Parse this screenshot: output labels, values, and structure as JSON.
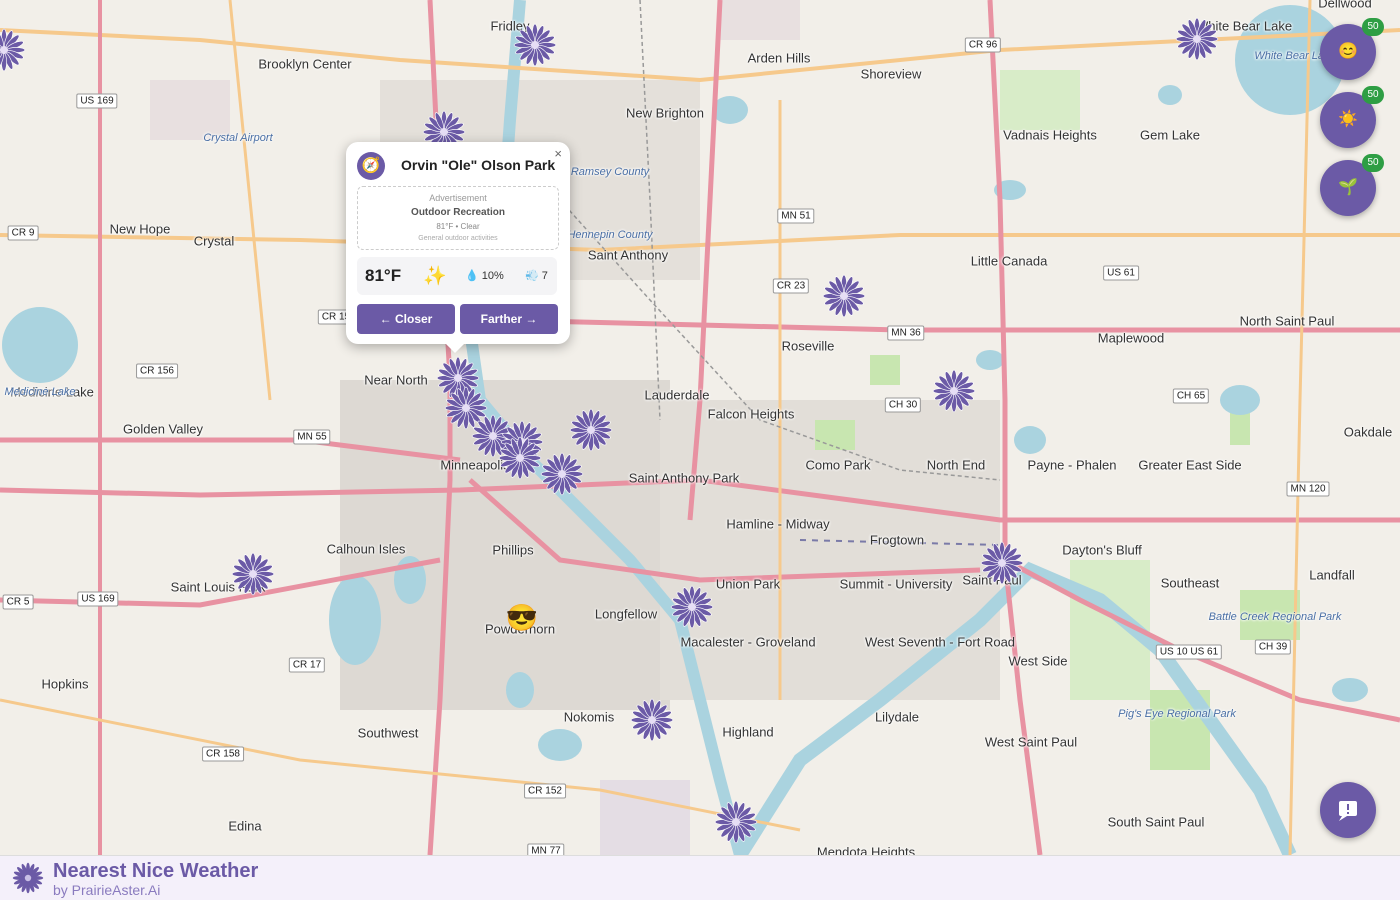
{
  "app": {
    "title": "Nearest Nice Weather",
    "subtitle": "by PrairieAster.Ai"
  },
  "map": {
    "places": [
      {
        "label": "Brooklyn Center"
      },
      {
        "label": "Fridley"
      },
      {
        "label": "Arden Hills"
      },
      {
        "label": "Shoreview"
      },
      {
        "label": "White Bear Lake"
      },
      {
        "label": "New Brighton"
      },
      {
        "label": "Vadnais Heights"
      },
      {
        "label": "Gem Lake"
      },
      {
        "label": "New Hope"
      },
      {
        "label": "Crystal"
      },
      {
        "label": "Saint Anthony"
      },
      {
        "label": "Little Canada"
      },
      {
        "label": "North Saint Paul"
      },
      {
        "label": "Roseville"
      },
      {
        "label": "Maplewood"
      },
      {
        "label": "Near North"
      },
      {
        "label": "Lauderdale"
      },
      {
        "label": "Falcon Heights"
      },
      {
        "label": "Golden Valley"
      },
      {
        "label": "Medicine Lake"
      },
      {
        "label": "Minneapolis"
      },
      {
        "label": "Como Park"
      },
      {
        "label": "North End"
      },
      {
        "label": "Payne - Phalen"
      },
      {
        "label": "Greater East Side"
      },
      {
        "label": "Oakdale"
      },
      {
        "label": "Saint Anthony Park"
      },
      {
        "label": "Hamline - Midway"
      },
      {
        "label": "Frogtown"
      },
      {
        "label": "Calhoun Isles"
      },
      {
        "label": "Phillips"
      },
      {
        "label": "Dayton's Bluff"
      },
      {
        "label": "Saint Louis Park"
      },
      {
        "label": "Union Park"
      },
      {
        "label": "Summit - University"
      },
      {
        "label": "Saint Paul"
      },
      {
        "label": "Southeast"
      },
      {
        "label": "Landfall"
      },
      {
        "label": "Longfellow"
      },
      {
        "label": "Powderhorn"
      },
      {
        "label": "Macalester - Groveland"
      },
      {
        "label": "West Seventh - Fort Road"
      },
      {
        "label": "West Side"
      },
      {
        "label": "Hopkins"
      },
      {
        "label": "Nokomis"
      },
      {
        "label": "Southwest"
      },
      {
        "label": "Highland"
      },
      {
        "label": "Lilydale"
      },
      {
        "label": "West Saint Paul"
      },
      {
        "label": "Edina"
      },
      {
        "label": "South Saint Paul"
      },
      {
        "label": "Mendota Heights"
      },
      {
        "label": "Dellwood"
      }
    ],
    "water_labels": [
      {
        "label": "Medicine Lake"
      },
      {
        "label": "Crystal Airport"
      },
      {
        "label": "Hennepin County"
      },
      {
        "label": "Ramsey County"
      },
      {
        "label": "Battle Creek Regional Park"
      },
      {
        "label": "Pig's Eye Regional Park"
      },
      {
        "label": "White Bear Lake"
      }
    ],
    "shields": [
      "US 169",
      "CR 9",
      "CR 156",
      "MN 55",
      "CR 5",
      "US 169",
      "CR 17",
      "CR 158",
      "CR 152",
      "MN 77",
      "CR 96",
      "MN 51",
      "CR 23",
      "MN 36",
      "CH 30",
      "US 61",
      "CH 65",
      "MN 120",
      "CH 39",
      "US 10 US 61",
      "CR 15"
    ],
    "markers": [
      {
        "name": "Orvin \"Ole\" Olson Park"
      },
      {
        "name": "Park"
      },
      {
        "name": "Park"
      },
      {
        "name": "Park"
      },
      {
        "name": "Park"
      },
      {
        "name": "Park"
      },
      {
        "name": "Park"
      },
      {
        "name": "Park"
      },
      {
        "name": "Park"
      },
      {
        "name": "Park"
      },
      {
        "name": "Park"
      },
      {
        "name": "Park"
      },
      {
        "name": "Park"
      },
      {
        "name": "Park"
      },
      {
        "name": "Park"
      },
      {
        "name": "Park"
      },
      {
        "name": "Park"
      },
      {
        "name": "Park"
      }
    ],
    "user_location_icon": "sunglasses-face-icon"
  },
  "popup": {
    "title": "Orvin \"Ole\" Olson Park",
    "close_label": "×",
    "ad": {
      "label": "Advertisement",
      "title": "Outdoor Recreation",
      "sub": "81°F • Clear",
      "desc": "General outdoor activities"
    },
    "weather": {
      "temp": "81°F",
      "condition_icon": "✨",
      "precip": "10%",
      "wind": "7"
    },
    "closer_label": "← Closer",
    "farther_label": "Farther →"
  },
  "filters": [
    {
      "name": "mood-filter",
      "icon": "😊",
      "count": "50"
    },
    {
      "name": "sun-filter",
      "icon": "☀️",
      "count": "50"
    },
    {
      "name": "sprout-filter",
      "icon": "🌱",
      "count": "50"
    }
  ],
  "colors": {
    "accent": "#6b5aa6",
    "badge": "#2e9e44",
    "footer_bg": "#f4f0fa"
  }
}
